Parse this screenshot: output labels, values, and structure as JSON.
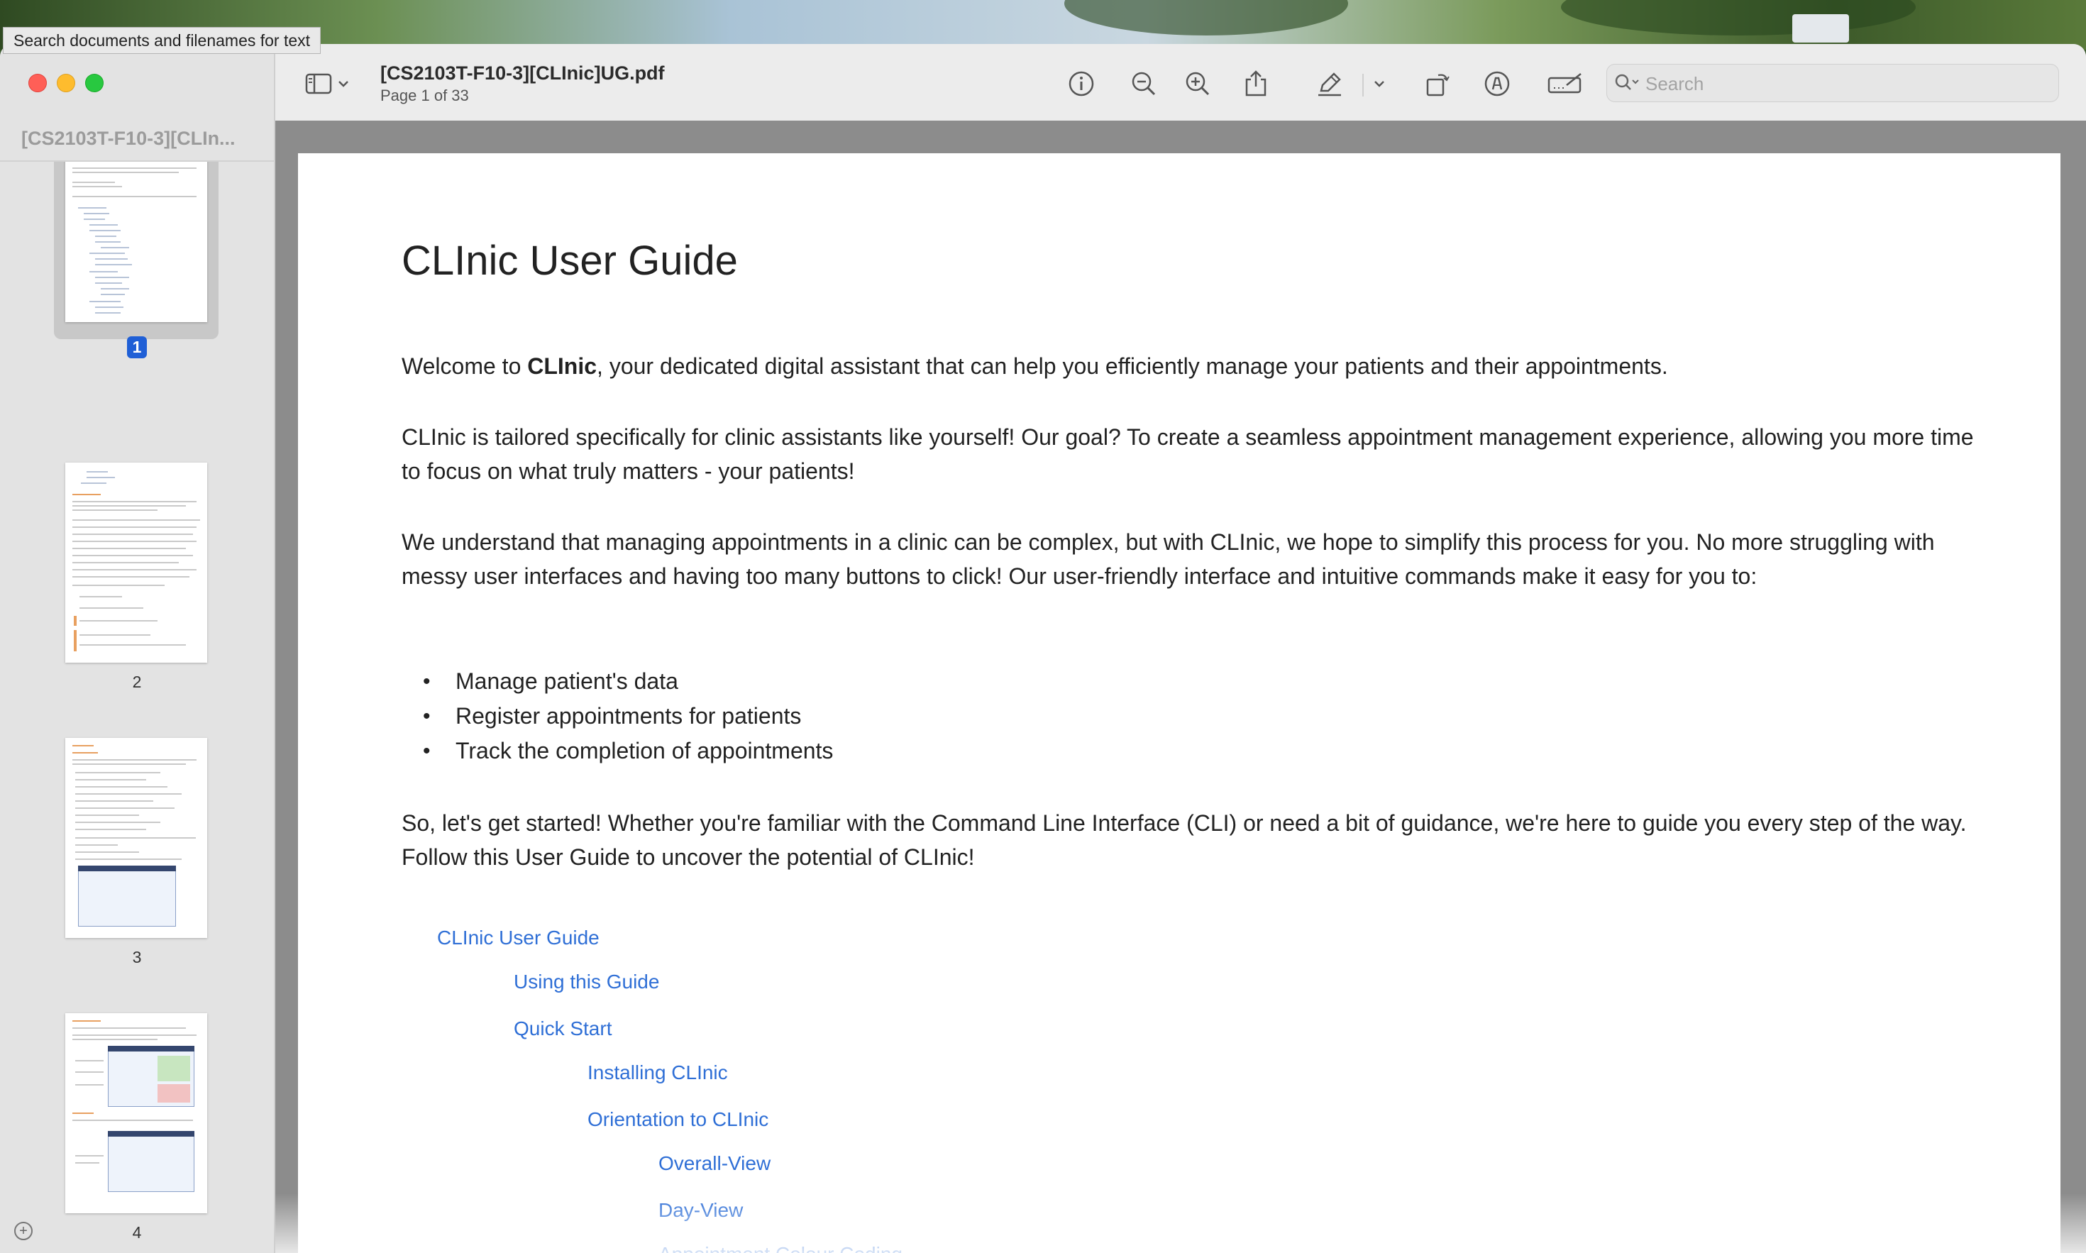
{
  "tooltip": "Search documents and filenames for text",
  "window": {
    "sidebar_title": "[CS2103T-F10-3][CLIn...",
    "doc_title": "[CS2103T-F10-3][CLInic]UG.pdf",
    "page_info": "Page 1 of 33"
  },
  "toolbar": {
    "search_placeholder": "Search",
    "icons": [
      "sidebar-toggle-icon",
      "chevron-down-icon",
      "info-icon",
      "zoom-out-icon",
      "zoom-in-icon",
      "share-icon",
      "highlight-pen-icon",
      "chevron-down-icon",
      "rotate-icon",
      "markup-icon",
      "sign-icon"
    ]
  },
  "thumbnails": [
    {
      "label": "1",
      "selected": true
    },
    {
      "label": "2",
      "selected": false
    },
    {
      "label": "3",
      "selected": false
    },
    {
      "label": "4",
      "selected": false
    }
  ],
  "document": {
    "title": "CLInic User Guide",
    "intro_before": "Welcome to ",
    "intro_bold": "CLInic",
    "intro_after": ", your dedicated digital assistant that can help you efficiently manage your patients and their appointments.",
    "para2": "CLInic is tailored specifically for clinic assistants like yourself! Our goal? To create a seamless appointment management experience, allowing you more time to focus on what truly matters - your patients!",
    "para3": "We understand that managing appointments in a clinic can be complex, but with CLInic, we hope to simplify this process for you. No more struggling with messy user interfaces and having too many buttons to click! Our user-friendly interface and intuitive commands make it easy for you to:",
    "bullets": [
      "Manage patient's data",
      "Register appointments for patients",
      "Track the completion of appointments"
    ],
    "para4": "So, let's get started! Whether you're familiar with the Command Line Interface (CLI) or need a bit of guidance, we're here to guide you every step of the way. Follow this User Guide to uncover the potential of CLInic!",
    "toc": [
      "CLInic User Guide",
      "Using this Guide",
      "Quick Start",
      "Installing CLInic",
      "Orientation to CLInic",
      "Overall-View",
      "Day-View",
      "Appointment Colour Coding"
    ]
  },
  "colors": {
    "link": "#2f6fd6",
    "selection": "#1f5fd6"
  }
}
